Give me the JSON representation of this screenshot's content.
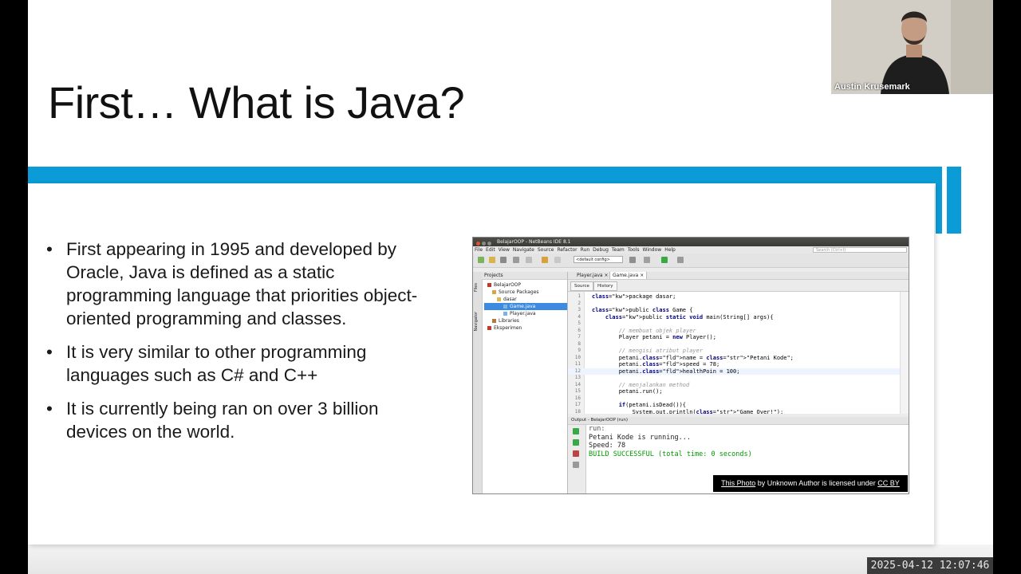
{
  "slide": {
    "title": "First… What is Java?",
    "bullets": [
      "First appearing in 1995 and developed by Oracle, Java is defined as a static programming language that priorities object-oriented programming and classes.",
      "It is very similar to other programming languages such as C# and C++",
      "It is currently being ran on over 3 billion devices on the world."
    ],
    "accent_color": "#0b9bd7"
  },
  "ide": {
    "window_title": "BelajarOOP - NetBeans IDE 8.1",
    "menu": [
      "File",
      "Edit",
      "View",
      "Navigate",
      "Source",
      "Refactor",
      "Run",
      "Debug",
      "Team",
      "Tools",
      "Window",
      "Help"
    ],
    "search_placeholder": "Search (Ctrl+I)",
    "config": "<default config>",
    "projects_tab": "Projects",
    "side_tabs": [
      "Files",
      "Navigator"
    ],
    "tree": [
      {
        "label": "BelajarOOP",
        "level": 0
      },
      {
        "label": "Source Packages",
        "level": 1
      },
      {
        "label": "dasar",
        "level": 2
      },
      {
        "label": "Game.java",
        "level": 3,
        "selected": true
      },
      {
        "label": "Player.java",
        "level": 3
      },
      {
        "label": "Libraries",
        "level": 1
      },
      {
        "label": "Eksperimen",
        "level": 0
      }
    ],
    "editor_tabs": [
      "Player.java",
      "Game.java"
    ],
    "source_btn": "Source",
    "history_btn": "History",
    "code_lines": [
      "package dasar;",
      "",
      "public class Game {",
      "    public static void main(String[] args){",
      "",
      "        // membuat objek player",
      "        Player petani = new Player();",
      "",
      "        // mengisi atribut player",
      "        petani.name = \"Petani Kode\";",
      "        petani.speed = 78;",
      "        petani.healthPoin = 100;",
      "",
      "        // menjalankan method",
      "        petani.run();",
      "",
      "        if(petani.isDead()){",
      "            System.out.println(\"Game Over!\");"
    ],
    "output_title": "Output - BelajarOOP (run)",
    "output_lines": [
      "run:",
      "Petani Kode is running...",
      "Speed: 78",
      "BUILD SUCCESSFUL (total time: 0 seconds)"
    ]
  },
  "credit": {
    "link1": "This Photo",
    "middle": " by Unknown Author is licensed under ",
    "link2": "CC BY"
  },
  "webcam": {
    "name": "Austin Krusemark"
  },
  "timestamp": "2025-04-12 12:07:46"
}
